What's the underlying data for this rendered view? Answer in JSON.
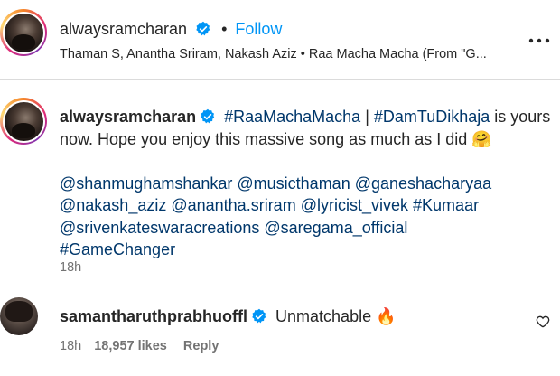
{
  "post": {
    "username": "alwaysramcharan",
    "follow_label": "Follow",
    "separator": "•",
    "audio": "Thaman S, Anantha Sriram, Nakash Aziz • Raa Macha Macha (From \"G..."
  },
  "caption": {
    "username": "alwaysramcharan",
    "hashtag1": "#RaaMachaMacha",
    "pipe": " | ",
    "hashtag2": "#DamTuDikhaja",
    "text_line1_end": " is yours",
    "text_line2": "now. Hope you enjoy this massive song as much as I did",
    "emoji": "🤗",
    "line3": [
      "@shanmughamshankar",
      "@musicthaman",
      "@ganeshacharyaa"
    ],
    "line4": [
      "@nakash_aziz",
      "@anantha.sriram",
      "@lyricist_vivek",
      "#Kumaar"
    ],
    "line5": [
      "@srivenkateswaracreations",
      "@saregama_official"
    ],
    "line6": [
      "#GameChanger"
    ],
    "time": "18h"
  },
  "comment": {
    "username": "samantharuthprabhuoffl",
    "text": "Unmatchable",
    "emoji": "🔥",
    "time": "18h",
    "likes": "18,957 likes",
    "reply_label": "Reply"
  },
  "icons": {
    "more": "more-options-icon",
    "verified": "verified-badge-icon",
    "heart": "heart-icon"
  },
  "colors": {
    "link": "#00376b",
    "follow": "#0095f6",
    "verified": "#0095f6",
    "muted": "#737373"
  }
}
